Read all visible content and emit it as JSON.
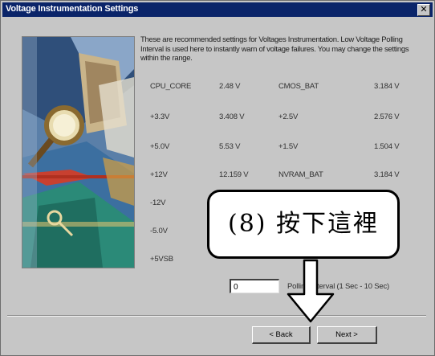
{
  "window": {
    "title": "Voltage Instrumentation Settings",
    "close_glyph": "✕"
  },
  "description": "These are recommended settings for Voltages Instrumentation. Low Voltage Polling Interval is used here to instantly warn of voltage failures. You may change the settings within the range.",
  "voltages_left": [
    {
      "label": "CPU_CORE",
      "value": "2.48 V"
    },
    {
      "label": "+3.3V",
      "value": "3.408 V"
    },
    {
      "label": "+5.0V",
      "value": "5.53 V"
    },
    {
      "label": "+12V",
      "value": "12.159 V"
    },
    {
      "label": "-12V",
      "value": ""
    },
    {
      "label": "-5.0V",
      "value": ""
    },
    {
      "label": "+5VSB",
      "value": ""
    }
  ],
  "voltages_right": [
    {
      "label": "CMOS_BAT",
      "value": "3.184 V"
    },
    {
      "label": "+2.5V",
      "value": "2.576 V"
    },
    {
      "label": "+1.5V",
      "value": "1.504 V"
    },
    {
      "label": "NVRAM_BAT",
      "value": "3.184 V"
    }
  ],
  "polling": {
    "value": "0",
    "label": "Polling Interval (1 Sec - 10 Sec)"
  },
  "buttons": {
    "back": "< Back",
    "next": "Next >"
  },
  "callout": {
    "text": "(8) 按下這裡"
  }
}
